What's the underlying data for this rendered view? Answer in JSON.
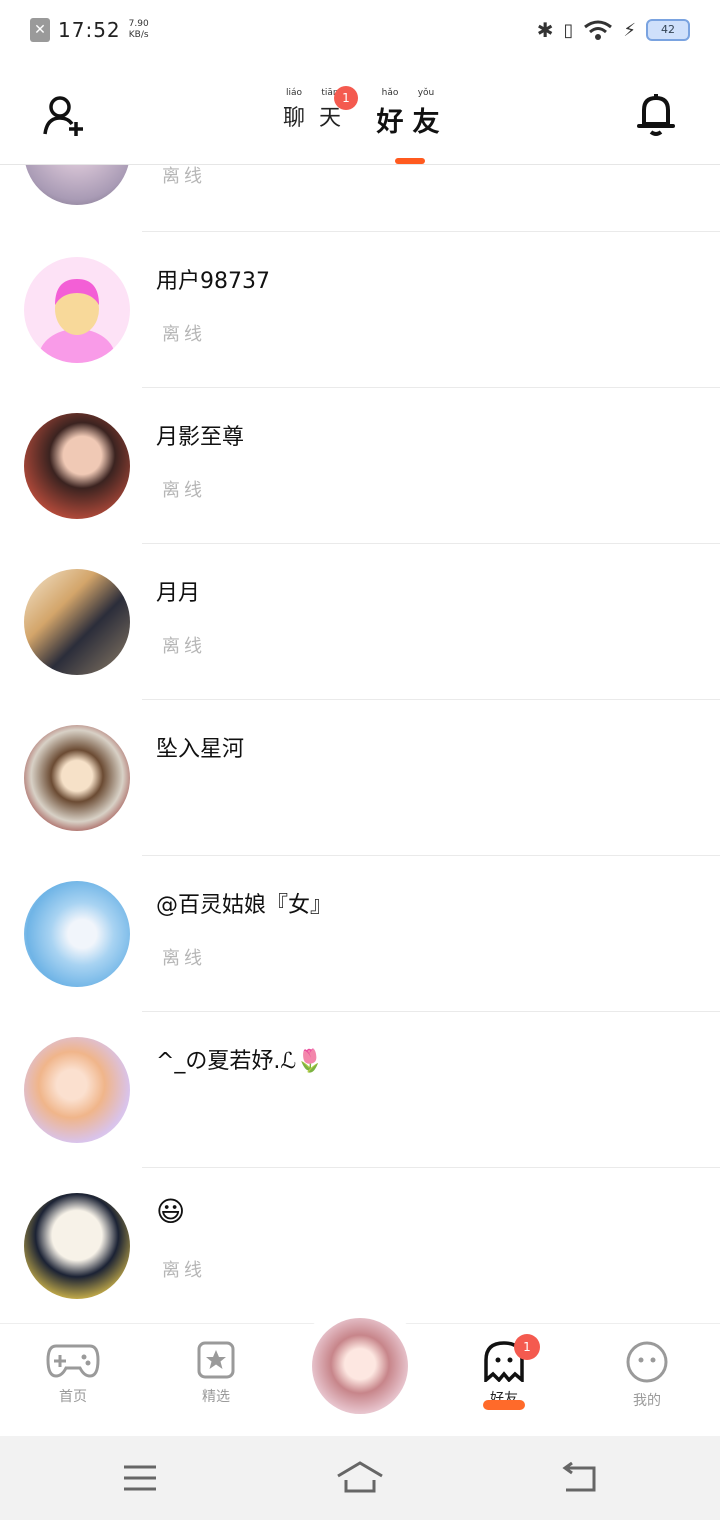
{
  "status_bar": {
    "time": "17:52",
    "net_speed_value": "7.90",
    "net_speed_unit": "KB/s",
    "battery": "42"
  },
  "header": {
    "tabs": [
      {
        "label": "聊天",
        "pinyin": [
          "liáo",
          "tiān"
        ],
        "active": false,
        "badge": "1"
      },
      {
        "label": "好友",
        "pinyin": [
          "hǎo",
          "yǒu"
        ],
        "active": true
      }
    ],
    "icons": {
      "left": "add-user-icon",
      "right": "bell-icon"
    }
  },
  "friends": [
    {
      "name": "",
      "status": "离线",
      "partial": true
    },
    {
      "name": "用户98737",
      "status": "离线"
    },
    {
      "name": "月影至尊",
      "status": "离线"
    },
    {
      "name": "月月",
      "status": "离线"
    },
    {
      "name": "坠入星河",
      "status": ""
    },
    {
      "name": "@百灵姑娘『女』",
      "status": "离线"
    },
    {
      "name": "^_の夏若妤.ℒ🌷",
      "status": ""
    },
    {
      "name": "😃",
      "status": "离线"
    }
  ],
  "bottom_nav": {
    "items": [
      {
        "label": "首页",
        "icon": "gamepad-icon"
      },
      {
        "label": "精选",
        "icon": "star-bookmark-icon"
      },
      {
        "label": "好友",
        "icon": "ghost-icon",
        "badge": "1",
        "active": true
      },
      {
        "label": "我的",
        "icon": "face-icon"
      }
    ]
  },
  "colors": {
    "accent": "#ff5a1f",
    "badge": "#f45a4f",
    "offline_text": "#b6b6b6"
  }
}
